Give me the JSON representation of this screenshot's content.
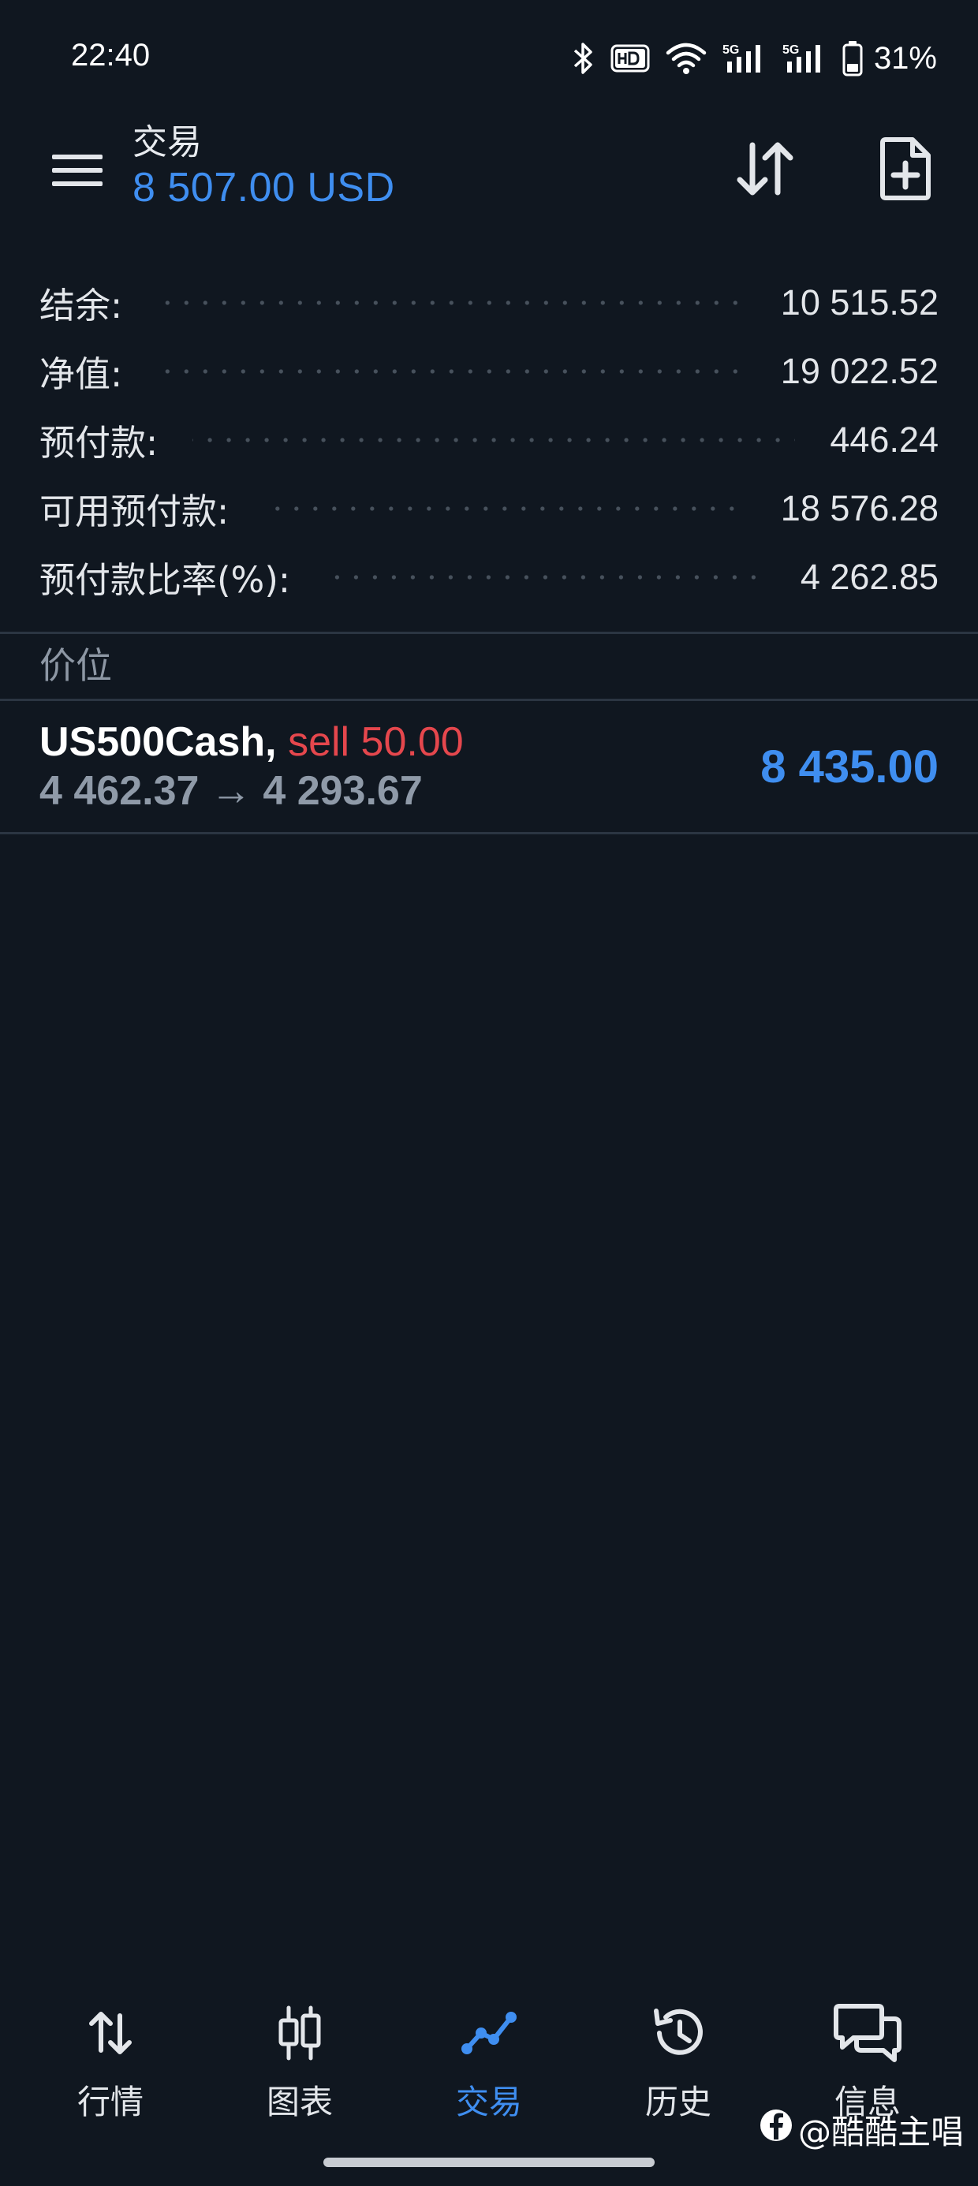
{
  "status_bar": {
    "time": "22:40",
    "battery": "31%",
    "icons": [
      "bluetooth-icon",
      "hd-voice-icon",
      "wifi-icon",
      "signal-5g-icon",
      "signal-5g-icon",
      "battery-icon"
    ]
  },
  "header": {
    "title": "交易",
    "balance": "8 507.00 USD",
    "icons": [
      "menu-icon",
      "sort-icon",
      "new-order-icon"
    ]
  },
  "summary": [
    {
      "label": "结余:",
      "value": "10 515.52"
    },
    {
      "label": "净值:",
      "value": "19 022.52"
    },
    {
      "label": "预付款:",
      "value": "446.24"
    },
    {
      "label": "可用预付款:",
      "value": "18 576.28"
    },
    {
      "label": "预付款比率(%):",
      "value": "4 262.85"
    }
  ],
  "positions_section": {
    "title": "价位"
  },
  "positions": [
    {
      "symbol": "US500Cash,",
      "type": "sell 50.00",
      "open_price": "4 462.37",
      "arrow": "→",
      "current_price": "4 293.67",
      "profit": "8 435.00"
    }
  ],
  "bottom_nav": [
    {
      "label": "行情",
      "icon": "quotes-icon",
      "active": false
    },
    {
      "label": "图表",
      "icon": "chart-icon",
      "active": false
    },
    {
      "label": "交易",
      "icon": "trade-icon",
      "active": true
    },
    {
      "label": "历史",
      "icon": "history-icon",
      "active": false
    },
    {
      "label": "信息",
      "icon": "messages-icon",
      "active": false
    }
  ],
  "watermark": {
    "text": "@酷酷主唱"
  },
  "colors": {
    "background": "#101720",
    "accent": "#3f8ef0",
    "sell": "#e5474d",
    "muted": "#8f9aa8"
  }
}
